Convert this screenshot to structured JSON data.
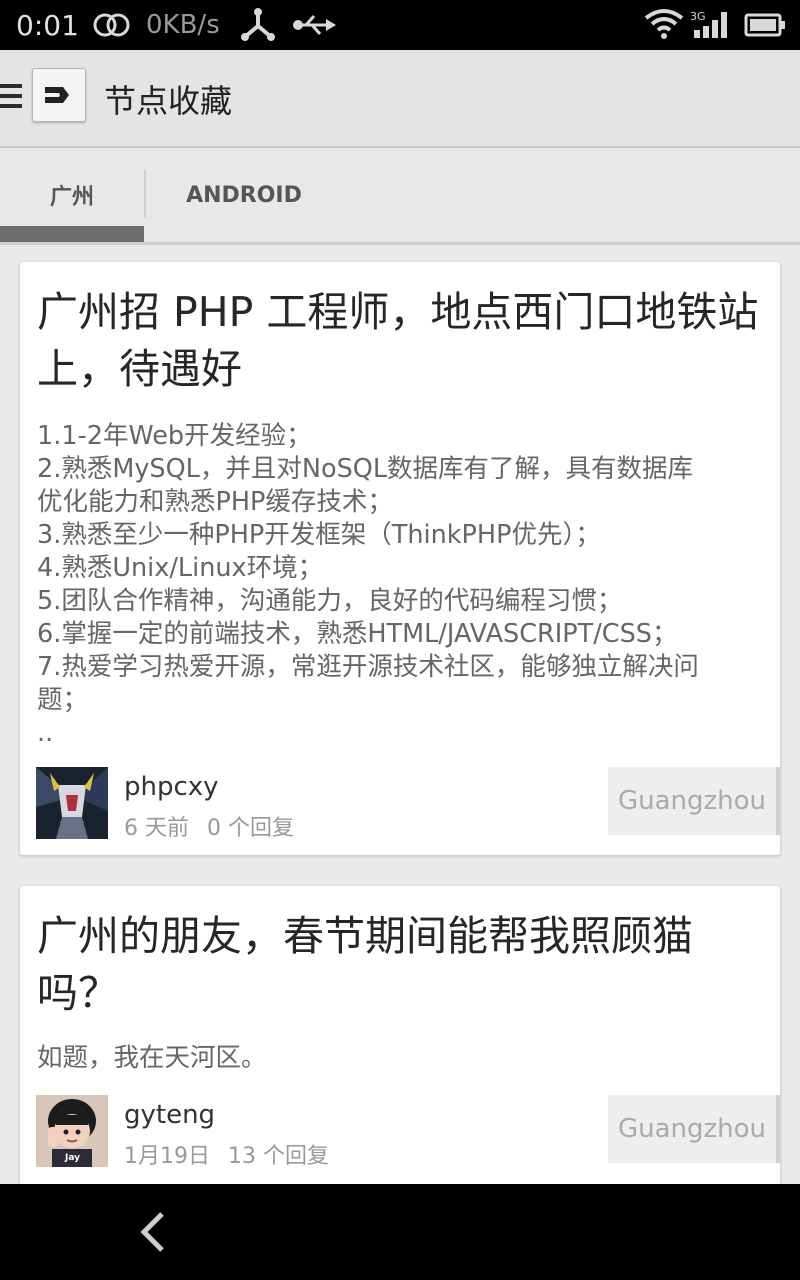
{
  "status_bar": {
    "time": "0:01",
    "speed": "0KB/s",
    "signal_label": "3G",
    "icons": [
      "rings-icon",
      "tether-icon",
      "usb-icon",
      "wifi-icon",
      "signal-icon",
      "battery-icon"
    ]
  },
  "action_bar": {
    "title": "节点收藏",
    "icons": [
      "menu-icon",
      "app-logo-icon"
    ]
  },
  "tabs": [
    {
      "label": "广州",
      "selected": true
    },
    {
      "label": "ANDROID",
      "selected": false
    }
  ],
  "topics": [
    {
      "title": "广州招 PHP 工程师，地点西门口地铁站上，待遇好",
      "body": [
        "1.1-2年Web开发经验；",
        "2.熟悉MySQL，并且对NoSQL数据库有了解，具有数据库",
        "优化能力和熟悉PHP缓存技术；",
        "3.熟悉至少一种PHP开发框架（ThinkPHP优先）；",
        "4.熟悉Unix/Linux环境；",
        "5.团队合作精神，沟通能力，良好的代码编程习惯；",
        "6.掌握一定的前端技术，熟悉HTML/JAVASCRIPT/CSS；",
        "7.热爱学习热爱开源，常逛开源技术社区，能够独立解决问",
        "题；",
        ".."
      ],
      "author": "phpcxy",
      "time": "6 天前",
      "replies": "0 个回复",
      "node": "Guangzhou"
    },
    {
      "title": "广州的朋友，春节期间能帮我照顾猫吗？",
      "body": [
        "如题，我在天河区。"
      ],
      "author": "gyteng",
      "time": "1月19日",
      "replies": "13 个回复",
      "node": "Guangzhou",
      "avatar_text": "Jay"
    }
  ],
  "nav_bar": {
    "icons": [
      "back-icon"
    ]
  }
}
